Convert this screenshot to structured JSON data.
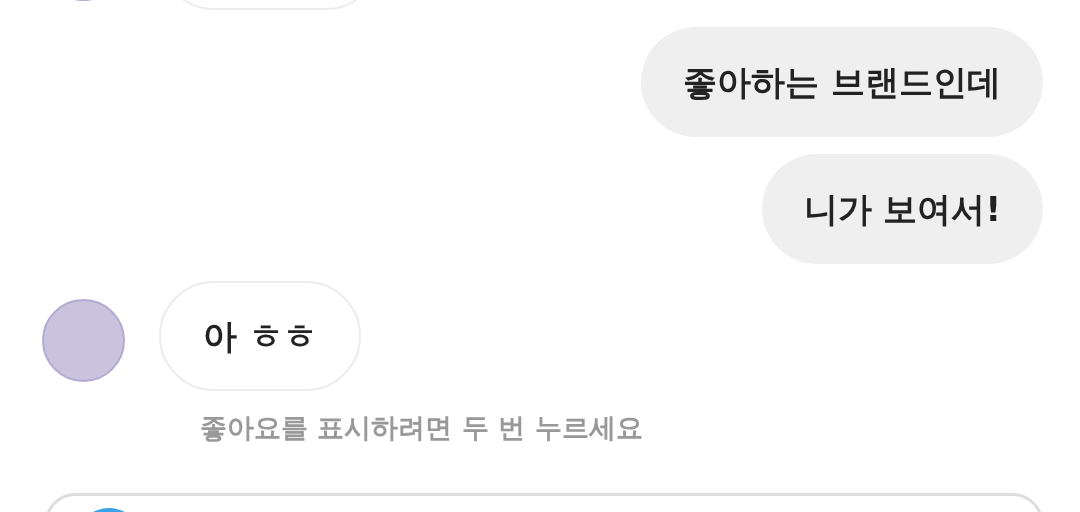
{
  "messages": [
    {
      "kind": "incoming"
    },
    {
      "kind": "outgoing",
      "text": "좋아하는 브랜드인데"
    },
    {
      "kind": "outgoing",
      "text": "니가 보여서!"
    },
    {
      "kind": "incoming",
      "text": "아 ㅎㅎ"
    }
  ],
  "like_hint": "좋아요를 표시하려면 두 번 누르세요",
  "composer": {
    "kind": "camera"
  }
}
